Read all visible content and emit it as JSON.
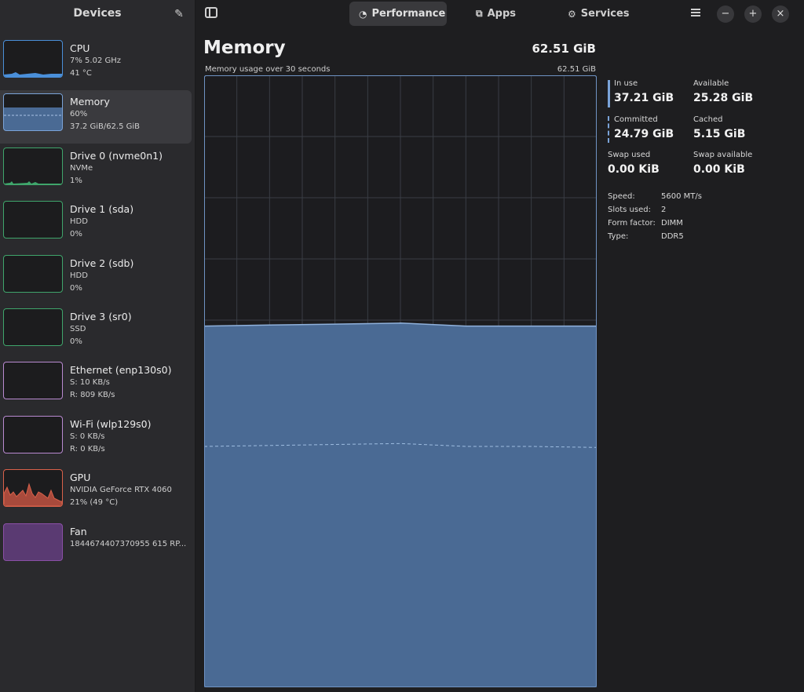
{
  "sidebar": {
    "title": "Devices",
    "edit_icon": "pencil-icon",
    "items": [
      {
        "name": "CPU",
        "line1": "7% 5.02 GHz",
        "line2": "41 °C",
        "color": "#4a8fd9"
      },
      {
        "name": "Memory",
        "line1": "60%",
        "line2": "37.2 GiB/62.5 GiB",
        "color": "#7aa3d8"
      },
      {
        "name": "Drive 0 (nvme0n1)",
        "line1": "NVMe",
        "line2": "1%",
        "color": "#3fa56b"
      },
      {
        "name": "Drive 1 (sda)",
        "line1": "HDD",
        "line2": "0%",
        "color": "#3fa56b"
      },
      {
        "name": "Drive 2 (sdb)",
        "line1": "HDD",
        "line2": "0%",
        "color": "#3fa56b"
      },
      {
        "name": "Drive 3 (sr0)",
        "line1": "SSD",
        "line2": "0%",
        "color": "#3fa56b"
      },
      {
        "name": "Ethernet (enp130s0)",
        "line1": "S: 10 KB/s",
        "line2": "R: 809 KB/s",
        "color": "#b98ad1"
      },
      {
        "name": "Wi-Fi (wlp129s0)",
        "line1": "S: 0 KB/s",
        "line2": "R: 0 KB/s",
        "color": "#b98ad1"
      },
      {
        "name": "GPU",
        "line1": "NVIDIA GeForce RTX 4060",
        "line2": "21% (49 °C)",
        "color": "#d9614a"
      },
      {
        "name": "Fan",
        "line1": "1844674407370955 615 RP...",
        "line2": "",
        "color": "#8a4fa6"
      }
    ]
  },
  "topbar": {
    "tabs": [
      {
        "label": "Performance",
        "icon": "gauge-icon"
      },
      {
        "label": "Apps",
        "icon": "apps-icon"
      },
      {
        "label": "Services",
        "icon": "gears-icon"
      }
    ],
    "window_buttons": [
      "−",
      "+",
      "×"
    ]
  },
  "main": {
    "title": "Memory",
    "total": "62.51 GiB",
    "graph_caption": "Memory usage over 30 seconds",
    "graph_max": "62.51 GiB",
    "stats": {
      "in_use_label": "In use",
      "in_use": "37.21 GiB",
      "available_label": "Available",
      "available": "25.28 GiB",
      "committed_label": "Committed",
      "committed": "24.79 GiB",
      "cached_label": "Cached",
      "cached": "5.15 GiB",
      "swap_used_label": "Swap used",
      "swap_used": "0.00 KiB",
      "swap_available_label": "Swap available",
      "swap_available": "0.00 KiB"
    },
    "specs": [
      {
        "label": "Speed:",
        "value": "5600 MT/s"
      },
      {
        "label": "Slots used:",
        "value": "2"
      },
      {
        "label": "Form factor:",
        "value": "DIMM"
      },
      {
        "label": "Type:",
        "value": "DDR5"
      }
    ]
  },
  "chart_data": {
    "type": "area",
    "x": [
      0,
      5,
      10,
      15,
      20,
      25,
      30
    ],
    "series": [
      {
        "values": [
          36.9,
          37.0,
          37.1,
          37.2,
          36.9,
          36.9,
          36.9
        ]
      },
      {
        "values": [
          24.6,
          24.7,
          24.8,
          24.9,
          24.6,
          24.6,
          24.5
        ]
      }
    ],
    "ylim": [
      0,
      62.51
    ],
    "grid": true,
    "colors": {
      "fill": "#4a6a94",
      "line": "#8fb1dc"
    }
  }
}
